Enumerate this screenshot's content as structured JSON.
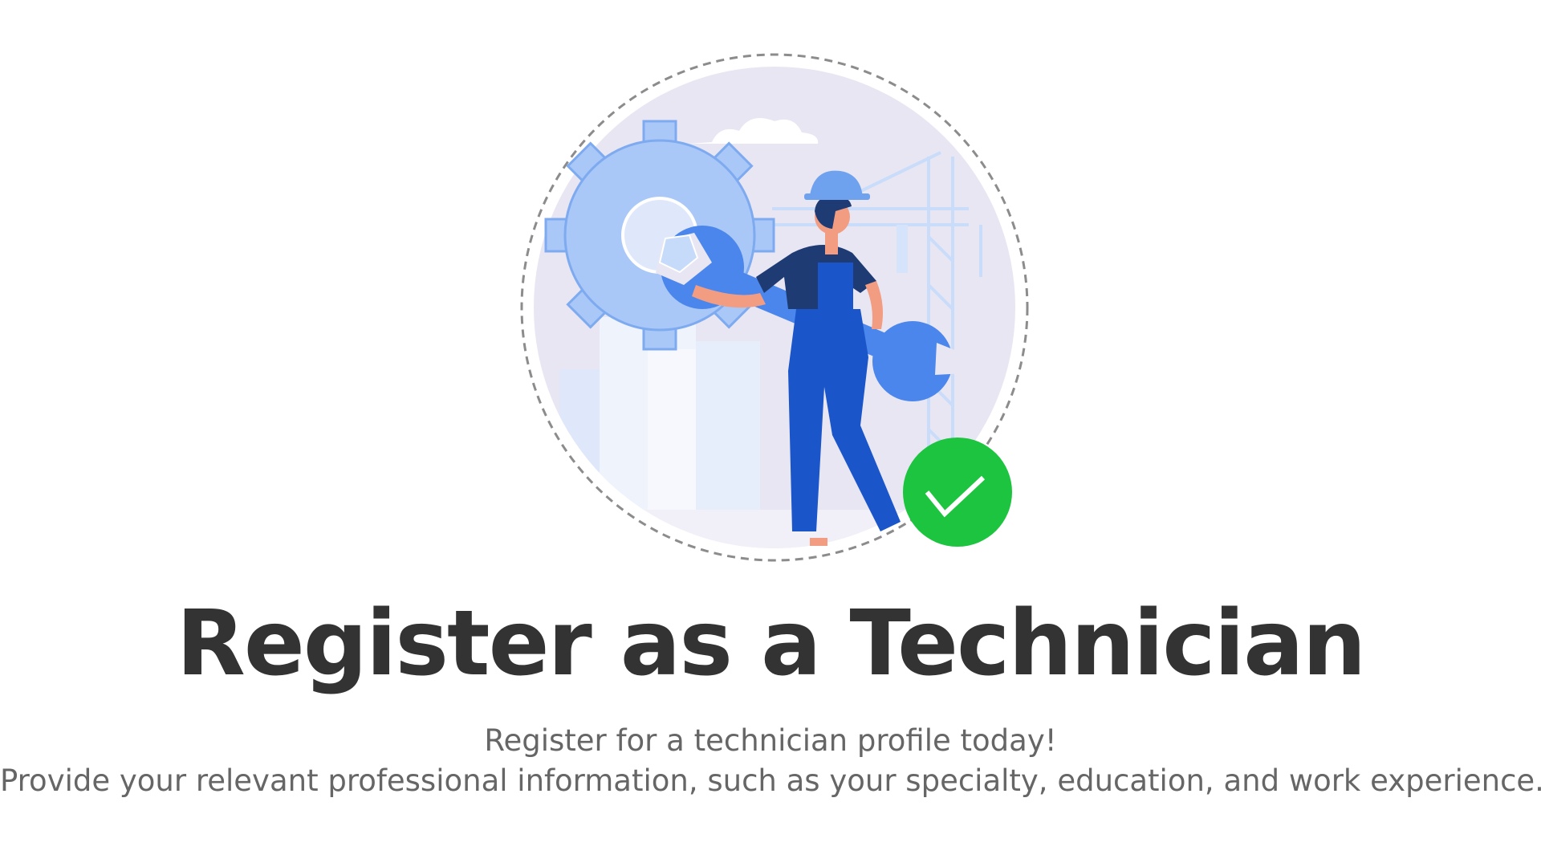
{
  "hero": {
    "illustration": "technician-with-wrench-and-gear",
    "badge_icon": "checkmark-icon",
    "colors": {
      "circle_bg": "#e8e6f3",
      "gear": "#a9c8f7",
      "wrench": "#4a86ec",
      "overalls": "#1a56c9",
      "shirt": "#1f3b73",
      "badge": "#1cc43f",
      "dashed_ring": "#8c8c8c"
    }
  },
  "content": {
    "title": "Register as a Technician",
    "subtitle_line1": "Register for a technician profile today!",
    "subtitle_line2": "Provide your relevant professional information, such as your specialty, education, and work experience.",
    "title_color": "#333333",
    "subtitle_color": "#666666"
  }
}
